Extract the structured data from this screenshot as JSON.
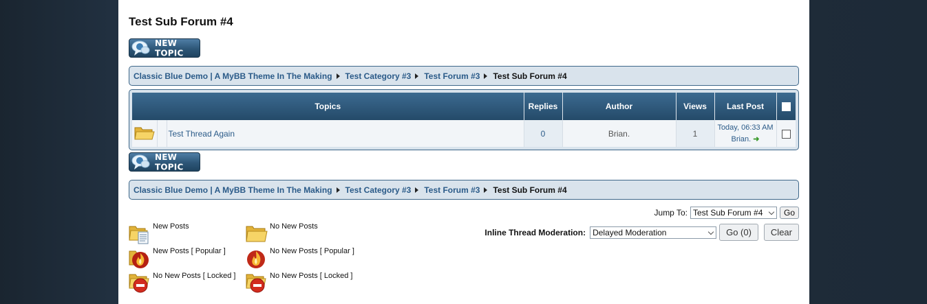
{
  "page_title": "Test Sub Forum #4",
  "new_topic_label": "NEW TOPIC",
  "breadcrumb": {
    "items": [
      "Classic Blue Demo | A MyBB Theme In The Making",
      "Test Category #3",
      "Test Forum #3"
    ],
    "current": "Test Sub Forum #4"
  },
  "table": {
    "headers": {
      "topics": "Topics",
      "replies": "Replies",
      "author": "Author",
      "views": "Views",
      "last_post": "Last Post"
    },
    "rows": [
      {
        "title": "Test Thread Again",
        "replies": "0",
        "author": "Brian.",
        "views": "1",
        "last_post_time": "Today, 06:33 AM",
        "last_post_user": "Brian."
      }
    ]
  },
  "jump_to": {
    "label": "Jump To:",
    "selected": "Test Sub Forum #4",
    "go": "Go"
  },
  "moderation": {
    "label": "Inline Thread Moderation:",
    "selected": "Delayed Moderation",
    "go": "Go (0)",
    "clear": "Clear"
  },
  "legend": [
    {
      "label": "New Posts",
      "icon": "folder-new-icon"
    },
    {
      "label": "No New Posts",
      "icon": "folder-icon"
    },
    {
      "label": "New Posts [ Popular ]",
      "icon": "fire-new-icon"
    },
    {
      "label": "No New Posts [ Popular ]",
      "icon": "fire-icon"
    },
    {
      "label": "No New Posts [ Locked ]",
      "icon": "folder-locked-new-icon"
    },
    {
      "label": "No New Posts [ Locked ]",
      "icon": "folder-locked-icon"
    }
  ],
  "colors": {
    "accent": "#2a5a88",
    "header": "#2d5677",
    "crumb_bg": "#d9e3ec"
  }
}
